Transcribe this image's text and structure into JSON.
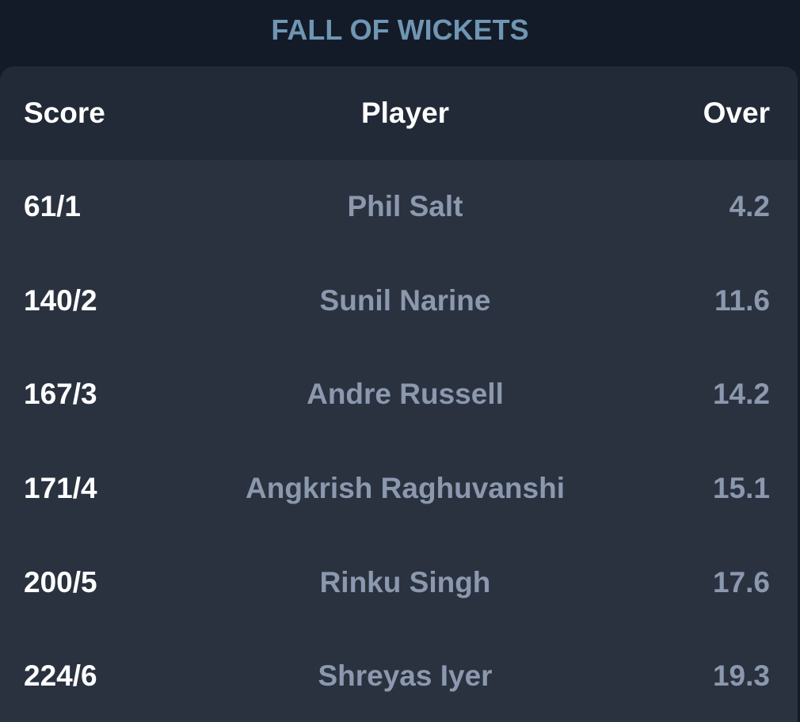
{
  "title": "FALL OF WICKETS",
  "columns": {
    "score": "Score",
    "player": "Player",
    "over": "Over"
  },
  "rows": [
    {
      "score": "61/1",
      "player": "Phil Salt",
      "over": "4.2"
    },
    {
      "score": "140/2",
      "player": "Sunil Narine",
      "over": "11.6"
    },
    {
      "score": "167/3",
      "player": "Andre Russell",
      "over": "14.2"
    },
    {
      "score": "171/4",
      "player": "Angkrish Raghuvanshi",
      "over": "15.1"
    },
    {
      "score": "200/5",
      "player": "Rinku Singh",
      "over": "17.6"
    },
    {
      "score": "224/6",
      "player": "Shreyas Iyer",
      "over": "19.3"
    }
  ],
  "colors": {
    "background": "#141b28",
    "title": "#6f96b3",
    "card": "#2a3240",
    "header": "#222a37",
    "score_text": "#ffffff",
    "secondary_text": "#8b98ae"
  }
}
